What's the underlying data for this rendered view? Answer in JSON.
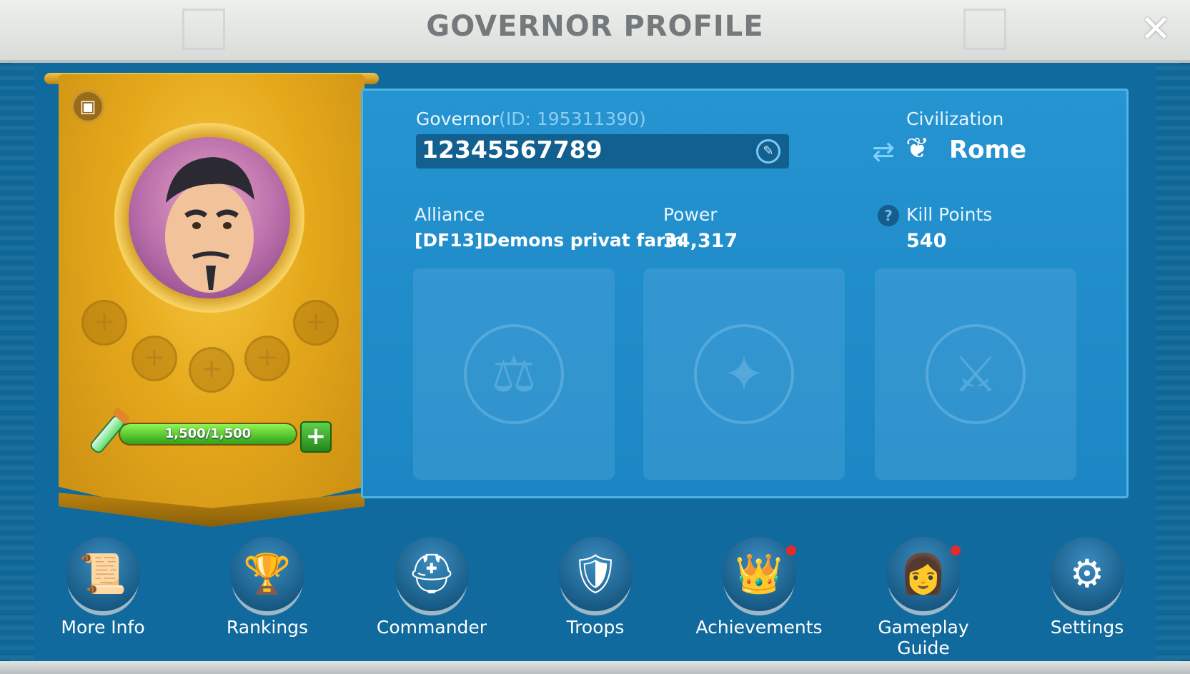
{
  "window": {
    "title": "GOVERNOR PROFILE"
  },
  "governor": {
    "label": "Governor",
    "id_text": "(ID: 195311390)",
    "name": "12345567789",
    "stamina": {
      "text": "1,500/1,500",
      "current": 1500,
      "max": 1500
    }
  },
  "civilization": {
    "label": "Civilization",
    "value": "Rome"
  },
  "alliance": {
    "label": "Alliance",
    "value": "[DF13]Demons privat farm"
  },
  "power": {
    "label": "Power",
    "value": "34,317"
  },
  "kill_points": {
    "label": "Kill Points",
    "value": "540"
  },
  "icons": {
    "photo": "photo-icon",
    "close": "close-icon",
    "edit": "edit-icon",
    "swap": "swap-icon",
    "laurel": "laurel-icon",
    "help": "help-icon",
    "plus": "plus-icon",
    "potion": "potion-icon"
  },
  "nav": [
    {
      "label": "More Info",
      "icon": "scroll-icon",
      "badge": false
    },
    {
      "label": "Rankings",
      "icon": "trophy-icon",
      "badge": false
    },
    {
      "label": "Commander",
      "icon": "helmet-icon",
      "badge": false
    },
    {
      "label": "Troops",
      "icon": "troops-icon",
      "badge": false
    },
    {
      "label": "Achievements",
      "icon": "crown-icon",
      "badge": true
    },
    {
      "label": "Gameplay Guide",
      "icon": "guide-icon",
      "badge": true
    },
    {
      "label": "Settings",
      "icon": "gear-icon",
      "badge": false
    }
  ],
  "colors": {
    "accent_blue": "#1b86c3",
    "banner_gold": "#e5a81b",
    "stamina_green": "#2fa21a",
    "badge_red": "#e52a2a"
  }
}
